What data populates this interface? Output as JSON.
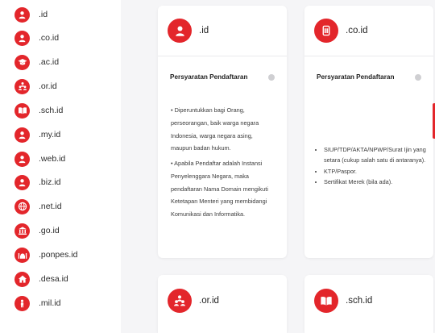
{
  "accent_color": "#e3262b",
  "sidebar": {
    "items": [
      {
        "label": ".id",
        "icon": "user-icon"
      },
      {
        "label": ".co.id",
        "icon": "user-icon"
      },
      {
        "label": ".ac.id",
        "icon": "graduation-cap-icon"
      },
      {
        "label": ".or.id",
        "icon": "people-icon"
      },
      {
        "label": ".sch.id",
        "icon": "book-icon"
      },
      {
        "label": ".my.id",
        "icon": "user-icon"
      },
      {
        "label": ".web.id",
        "icon": "user-icon"
      },
      {
        "label": ".biz.id",
        "icon": "user-icon"
      },
      {
        "label": ".net.id",
        "icon": "globe-icon"
      },
      {
        "label": ".go.id",
        "icon": "building-icon"
      },
      {
        "label": ".ponpes.id",
        "icon": "mosque-icon"
      },
      {
        "label": ".desa.id",
        "icon": "house-icon"
      },
      {
        "label": ".mil.id",
        "icon": "person-icon"
      }
    ]
  },
  "cards": {
    "id": {
      "title": ".id",
      "icon": "user-icon",
      "requirements_title": "Persyaratan Pendaftaran",
      "paragraphs": [
        "• Diperuntukkan bagi Orang, perseorangan, baik warga negara Indonesia, warga negara asing, maupun badan hukum.",
        "• Apabila Pendaftar adalah Instansi Penyelenggara Negara, maka pendaftaran Nama Domain mengikuti Ketetapan Menteri yang membidangi Komunikasi dan Informatika."
      ]
    },
    "co_id": {
      "title": ".co.id",
      "icon": "document-icon",
      "requirements_title": "Persyaratan Pendaftaran",
      "items": [
        "SIUP/TDP/AKTA/NPWP/Surat Ijin yang setara (cukup salah satu di antaranya).",
        "KTP/Paspor.",
        "Sertifikat Merek (bila ada)."
      ]
    },
    "or_id": {
      "title": ".or.id",
      "icon": "people-icon"
    },
    "sch_id": {
      "title": ".sch.id",
      "icon": "book-icon"
    }
  }
}
